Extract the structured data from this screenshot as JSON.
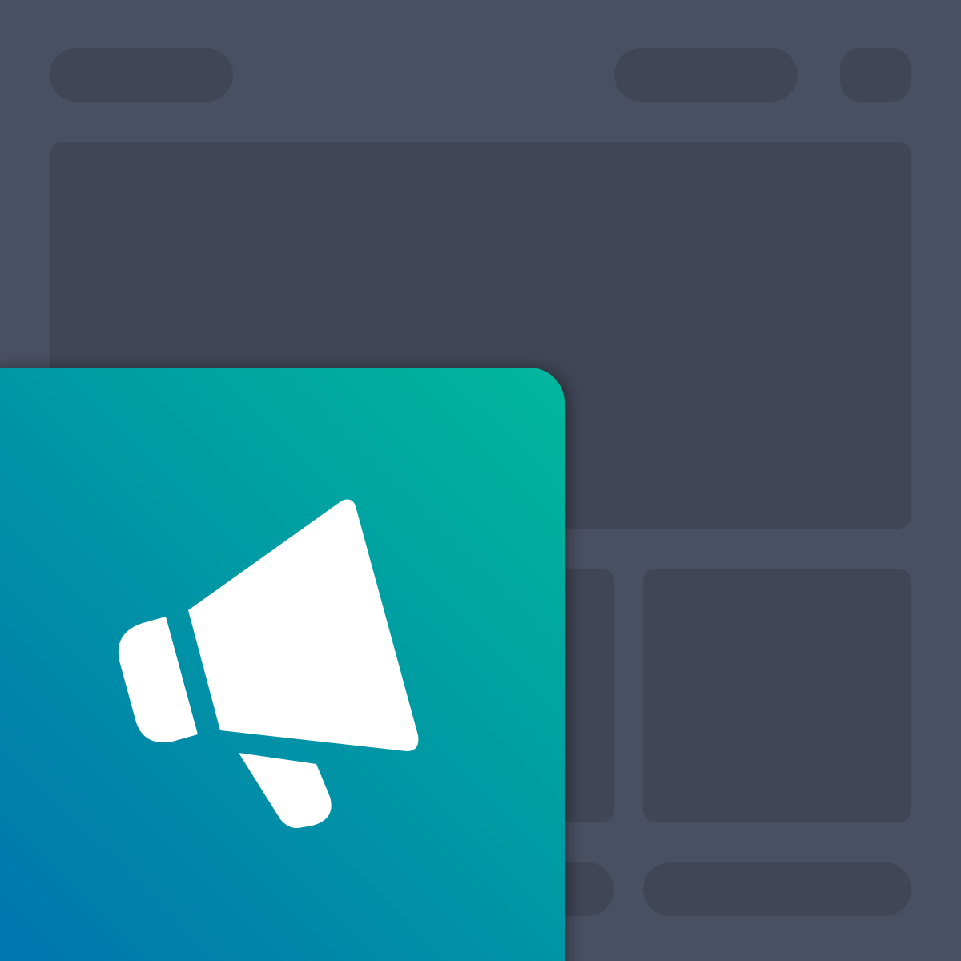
{
  "colors": {
    "background": "#4a5063",
    "placeholder_block": "#404656",
    "tile_gradient_start": "#00b89b",
    "tile_gradient_end": "#0070b0",
    "icon_fill": "#ffffff"
  },
  "tile": {
    "icon": "megaphone-icon"
  }
}
